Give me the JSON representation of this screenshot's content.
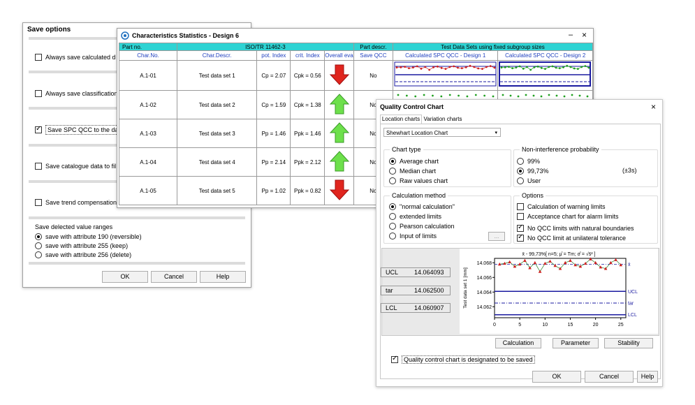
{
  "save_options": {
    "title": "Save options",
    "options": [
      {
        "label": "Always save calculated d",
        "checked": false
      },
      {
        "label": "Always save classification",
        "checked": false
      },
      {
        "label": "Save SPC QCC to the dat",
        "checked": true
      },
      {
        "label": "Save catalogue data to fil",
        "checked": false
      },
      {
        "label": "Save trend compensation",
        "checked": false
      }
    ],
    "ranges_title": "Save delected value ranges",
    "ranges": [
      {
        "label": "save with attribute 190 (reversible)",
        "selected": true
      },
      {
        "label": "save with attribute 255 (keep)",
        "selected": false
      },
      {
        "label": "save with attribute 256 (delete)",
        "selected": false
      }
    ],
    "ok": "OK",
    "cancel": "Cancel",
    "help": "Help"
  },
  "char_stats": {
    "title": "Characteristics Statistics - Design 6",
    "minimize": "–",
    "close": "×",
    "part_no_label": "Part no.",
    "part_no_value": "ISO/TR 11462-3",
    "part_descr_label": "Part descr.",
    "part_descr_value": "Test Data Sets using fixed subgroup sizes",
    "headers": [
      "Char.No.",
      "Char.Descr.",
      "pot. Index",
      "crit. Index",
      "Overall eva",
      "Save QCC",
      "Calculated SPC QCC - Design 1",
      "Calculated SPC QCC - Design 2"
    ],
    "rows": [
      {
        "no": "A.1-01",
        "descr": "Test data set 1",
        "pot": "Cp  = 2.07",
        "crit": "Cpk = 0.56",
        "eval": "down",
        "save": "No"
      },
      {
        "no": "A.1-02",
        "descr": "Test data set 2",
        "pot": "Cp  = 1.59",
        "crit": "Cpk = 1.38",
        "eval": "up",
        "save": "No"
      },
      {
        "no": "A.1-03",
        "descr": "Test data set 3",
        "pot": "Pp  = 1.46",
        "crit": "Ppk = 1.46",
        "eval": "up",
        "save": "No"
      },
      {
        "no": "A.1-04",
        "descr": "Test data set 4",
        "pot": "Pp  = 2.14",
        "crit": "Ppk = 2.12",
        "eval": "up",
        "save": "No"
      },
      {
        "no": "A.1-05",
        "descr": "Test data set 5",
        "pot": "Pp  = 1.02",
        "crit": "Ppk = 0.82",
        "eval": "down",
        "save": "No"
      }
    ]
  },
  "qcc": {
    "title": "Quality Control Chart",
    "close": "×",
    "tabs": [
      "Location charts",
      "Variation charts"
    ],
    "chart_select": "Shewhart Location Chart",
    "chart_type_title": "Chart type",
    "chart_types": [
      {
        "label": "Average chart",
        "selected": true
      },
      {
        "label": "Median chart",
        "selected": false
      },
      {
        "label": "Raw values chart",
        "selected": false
      }
    ],
    "nip_title": "Non-interference probability",
    "nip": [
      {
        "label": "99%",
        "selected": false
      },
      {
        "label": "99,73%",
        "selected": true
      },
      {
        "label": "User",
        "selected": false
      }
    ],
    "nip_sigma": "(±3s)",
    "calc_title": "Calculation method",
    "calc": [
      {
        "label": "\"normal calculation\"",
        "selected": true
      },
      {
        "label": "extended limits",
        "selected": false
      },
      {
        "label": "Pearson calculation",
        "selected": false
      },
      {
        "label": "Input of limits",
        "selected": false
      }
    ],
    "limits_btn": "...",
    "options_title": "Options",
    "options": [
      {
        "label": "Calculation of warning limits",
        "checked": false
      },
      {
        "label": "Acceptance chart for alarm limits",
        "checked": false
      },
      {
        "label": "No QCC limits with natural boundaries",
        "checked": true
      },
      {
        "label": "No QCC limit at unilateral tolerance",
        "checked": true
      }
    ],
    "ucl_label": "UCL",
    "ucl_value": "14.064093",
    "tar_label": "tar",
    "tar_value": "14.062500",
    "lcl_label": "LCL",
    "lcl_value": "14.060907",
    "chart_header": "x̄ - 99,73%[ n=5; μ̂ = Tm; σ̂ = √s̄² ]",
    "btn_calc": "Calculation",
    "btn_param": "Parameter",
    "btn_stab": "Stability",
    "save_label": "Quality control chart is designated to be saved",
    "save_checked": true,
    "ok": "OK",
    "cancel": "Cancel",
    "help": "Help"
  },
  "chart_data": {
    "type": "line",
    "title": "x̄ - 99,73%[ n=5; μ̂ = Tm; σ̂ = √s̄² ]",
    "xlabel": "",
    "ylabel": "Test data set 1 [mm]",
    "xlim": [
      0,
      26
    ],
    "ylim": [
      14.0605,
      14.0686
    ],
    "xticks": [
      0,
      5,
      10,
      15,
      20,
      25
    ],
    "yticks": [
      14.062,
      14.064,
      14.066,
      14.068
    ],
    "right_labels": [
      "x̄",
      "UCL",
      "tar",
      "LCL"
    ],
    "x": [
      1,
      2,
      3,
      4,
      5,
      6,
      7,
      8,
      9,
      10,
      11,
      12,
      13,
      14,
      15,
      16,
      17,
      18,
      19,
      20,
      21,
      22,
      23,
      24,
      25
    ],
    "values": [
      14.0678,
      14.0679,
      14.0681,
      14.0675,
      14.0678,
      14.0683,
      14.0673,
      14.068,
      14.0668,
      14.0679,
      14.0682,
      14.0676,
      14.0672,
      14.068,
      14.0683,
      14.0677,
      14.0675,
      14.0679,
      14.0685,
      14.068,
      14.0674,
      14.0672,
      14.068,
      14.0684,
      14.0677
    ],
    "mean": 14.0678,
    "ucl": 14.064093,
    "tar": 14.0625,
    "lcl": 14.060907
  }
}
